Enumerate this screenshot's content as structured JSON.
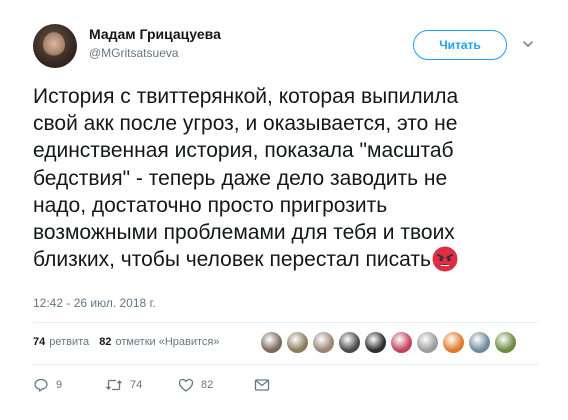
{
  "author": {
    "name": "Мадам Грицацуева",
    "handle": "@MGritsatsueva"
  },
  "follow_button": {
    "label": "Читать"
  },
  "tweet": {
    "lines": [
      "История с твиттерянкой, которая выпилила",
      "свой акк после угроз, и оказывается, это не",
      "единственная история, показала \"масштаб",
      "бедствия\" - теперь даже дело заводить не",
      "надо, достаточно просто пригрозить",
      "возможными проблемами для тебя и твоих",
      "близких, чтобы человек перестал писать"
    ],
    "emoji": "angry-face-emoji",
    "timestamp": "12:42 - 26 июл. 2018 г."
  },
  "stats": {
    "retweets_count": "74",
    "retweets_label": "ретвита",
    "likes_count": "82",
    "likes_label": "отметки «Нравится»"
  },
  "likers": [
    {
      "color": "#7b6a5a"
    },
    {
      "color": "#8a7b5f"
    },
    {
      "color": "#9a8575"
    },
    {
      "color": "#4a4a4a"
    },
    {
      "color": "#2d2d2d"
    },
    {
      "color": "#c0445b"
    },
    {
      "color": "#9c9c9c"
    },
    {
      "color": "#e07a2a"
    },
    {
      "color": "#6f8a9a"
    },
    {
      "color": "#6e8a3e"
    }
  ],
  "actions": {
    "reply_count": "9",
    "retweet_count": "74",
    "like_count": "82"
  },
  "colors": {
    "accent": "#1da1f2",
    "text": "#14171a",
    "muted": "#657786",
    "divider": "#e6ecf0"
  }
}
